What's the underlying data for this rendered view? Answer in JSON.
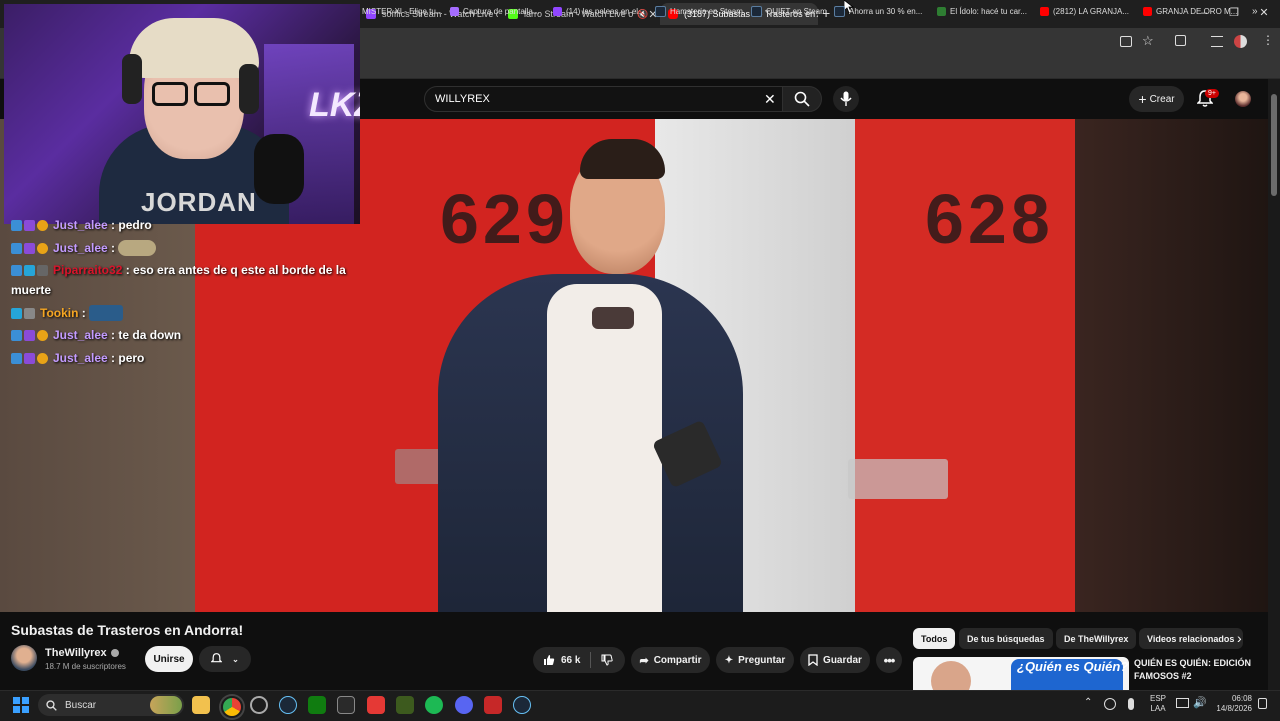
{
  "browser": {
    "tabs": [
      {
        "title": "sofffics Stream - Watch Live on",
        "color": "#9146ff",
        "active": false
      },
      {
        "title": "larro Stream - Watch Live o",
        "color": "#53fc18",
        "active": false
      },
      {
        "title": "(3187) Subastas de Trasteros en",
        "color": "#ff0000",
        "active": true
      }
    ],
    "new_tab": "+",
    "bookmarks": [
      "MISTER XI - Elige tu...",
      "Captura de pantalla...",
      "(14) las peleas en el...",
      "Hamsteria en Steam",
      "QUIET en Steam",
      "Ahorra un 30 % en...",
      "El Ídolo: hacé tu car...",
      "(2812) LA GRANJA...",
      "GRANJA DE ORO M..."
    ],
    "bookmarks_more": "»"
  },
  "youtube": {
    "search_value": "WILLYREX",
    "create_label": "Crear",
    "notif_count": "9+",
    "video": {
      "door_left": "629",
      "door_right": "628"
    },
    "title": "Subastas de Trasteros en Andorra!",
    "channel": {
      "name": "TheWillyrex",
      "subs": "18.7 M de suscriptores",
      "join_label": "Unirse"
    },
    "actions": {
      "likes": "66 k",
      "share": "Compartir",
      "ask": "Preguntar",
      "save": "Guardar"
    },
    "chips": [
      "Todos",
      "De tus búsquedas",
      "De TheWillyrex",
      "Videos relacionados"
    ],
    "related": {
      "title": "QUIÉN ES QUIÉN: EDICIÓN FAMOSOS #2",
      "thumb_text": "¿Quién es Quién?"
    }
  },
  "chat": [
    {
      "user": "Just_alee",
      "msg": "pedro",
      "color": "#c39bff"
    },
    {
      "user": "Just_alee",
      "msg": "",
      "color": "#c39bff"
    },
    {
      "user": "Piparraito32",
      "msg": "eso era antes de q este al borde de la",
      "msg2": "muerte",
      "color": "#d9142b"
    },
    {
      "user": "Tookin",
      "msg": "",
      "color": "#f5a623"
    },
    {
      "user": "Just_alee",
      "msg": "te da down",
      "color": "#c39bff"
    },
    {
      "user": "Just_alee",
      "msg": "pero",
      "color": "#c39bff"
    }
  ],
  "webcam": {
    "neon": "LKZ",
    "shirt": "JORDAN"
  },
  "taskbar": {
    "search_placeholder": "Buscar",
    "lang": "ESP",
    "lang2": "LAA",
    "time": "06:08",
    "date": "14/8/2026"
  }
}
